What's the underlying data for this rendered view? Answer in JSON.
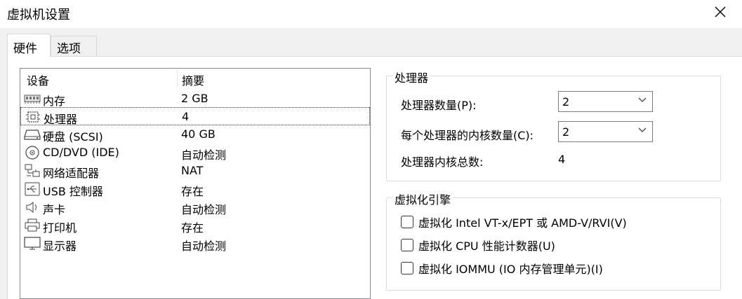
{
  "window": {
    "title": "虚拟机设置",
    "close_icon": "close-icon"
  },
  "tabs": [
    {
      "label": "硬件",
      "active": true
    },
    {
      "label": "选项",
      "active": false
    }
  ],
  "device_list": {
    "header": {
      "device": "设备",
      "summary": "摘要"
    },
    "rows": [
      {
        "name": "内存",
        "summary": "2 GB",
        "icon": "memory-icon",
        "selected": false
      },
      {
        "name": "处理器",
        "summary": "4",
        "icon": "processor-icon",
        "selected": true
      },
      {
        "name": "硬盘 (SCSI)",
        "summary": "40 GB",
        "icon": "harddisk-icon",
        "selected": false
      },
      {
        "name": "CD/DVD (IDE)",
        "summary": "自动检测",
        "icon": "cdrom-icon",
        "selected": false
      },
      {
        "name": "网络适配器",
        "summary": "NAT",
        "icon": "network-icon",
        "selected": false
      },
      {
        "name": "USB 控制器",
        "summary": "存在",
        "icon": "usb-icon",
        "selected": false
      },
      {
        "name": "声卡",
        "summary": "自动检测",
        "icon": "sound-icon",
        "selected": false
      },
      {
        "name": "打印机",
        "summary": "存在",
        "icon": "printer-icon",
        "selected": false
      },
      {
        "name": "显示器",
        "summary": "自动检测",
        "icon": "display-icon",
        "selected": false
      }
    ]
  },
  "processor": {
    "group_title": "处理器",
    "count_label": "处理器数量(P):",
    "count_value": "2",
    "cores_label": "每个处理器的内核数量(C):",
    "cores_value": "2",
    "total_label": "处理器内核总数:",
    "total_value": "4"
  },
  "virtualization": {
    "group_title": "虚拟化引擎",
    "options": [
      {
        "label": "虚拟化 Intel VT-x/EPT 或 AMD-V/RVI(V)",
        "checked": false
      },
      {
        "label": "虚拟化 CPU 性能计数器(U)",
        "checked": false
      },
      {
        "label": "虚拟化 IOMMU (IO 内存管理单元)(I)",
        "checked": false
      }
    ]
  }
}
